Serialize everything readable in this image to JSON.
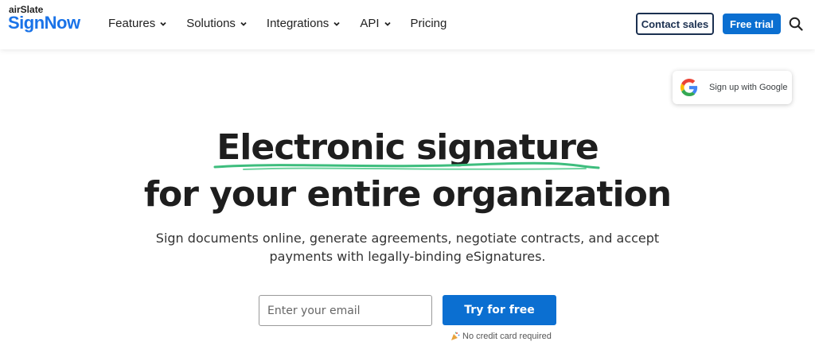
{
  "header": {
    "logo_small": "airSlate",
    "logo_big": "SignNow",
    "nav": [
      {
        "label": "Features",
        "has_dropdown": true
      },
      {
        "label": "Solutions",
        "has_dropdown": true
      },
      {
        "label": "Integrations",
        "has_dropdown": true
      },
      {
        "label": "API",
        "has_dropdown": true
      },
      {
        "label": "Pricing",
        "has_dropdown": false
      }
    ],
    "contact_label": "Contact sales",
    "trial_label": "Free trial",
    "search_icon": "search-icon"
  },
  "google_popup": {
    "label": "Sign up with Google",
    "icon": "google-g-icon"
  },
  "hero": {
    "title_line1": "Electronic signature",
    "title_line2": "for your entire organization",
    "subtitle_line1": "Sign documents online, generate agreements, negotiate contracts, and accept",
    "subtitle_line2": "payments with legally-binding eSignatures."
  },
  "form": {
    "email_placeholder": "Enter your email",
    "email_value": "",
    "cta_label": "Try for free",
    "note": "No credit card required",
    "note_icon": "party-popper-icon"
  },
  "colors": {
    "brand_blue": "#0b6fd1",
    "logo_blue": "#1a73e8",
    "navy": "#1b3050",
    "underline_green": "#3dbd7d"
  }
}
